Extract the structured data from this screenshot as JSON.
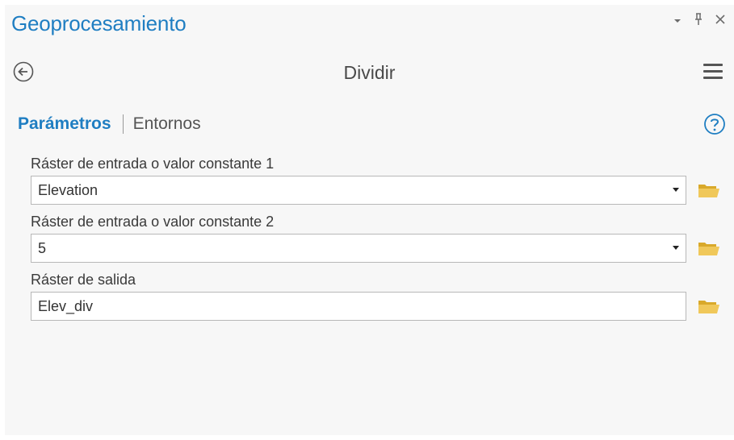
{
  "pane": {
    "title": "Geoprocesamiento",
    "controls": {
      "dropdown_glyph": "▾",
      "pin_glyph": "ᵖ",
      "close_glyph": "✕"
    }
  },
  "toolbar": {
    "tool_title": "Dividir"
  },
  "tabs": {
    "active": "Parámetros",
    "inactive": "Entornos"
  },
  "parameters": [
    {
      "label": "Ráster de entrada o valor constante 1",
      "value": "Elevation",
      "has_dropdown": true
    },
    {
      "label": "Ráster de entrada o valor constante 2",
      "value": "5",
      "has_dropdown": true
    },
    {
      "label": "Ráster de salida",
      "value": "Elev_div",
      "has_dropdown": false
    }
  ],
  "colors": {
    "accent": "#1f7ec2",
    "folder": "#e8c04a"
  },
  "icons": [
    "back-arrow-icon",
    "menu-icon",
    "help-icon",
    "folder-icon",
    "chevron-down-icon",
    "pin-icon",
    "close-icon"
  ]
}
